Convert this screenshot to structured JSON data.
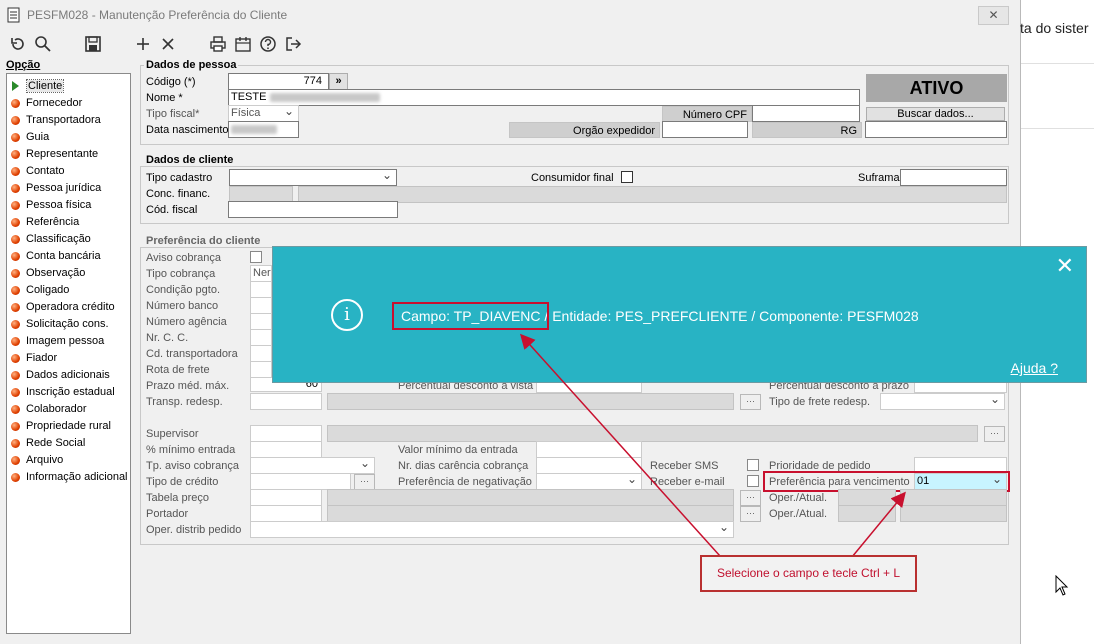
{
  "window": {
    "title": "PESFM028 - Manutenção Preferência do Cliente",
    "close": "✕"
  },
  "toolbar": {
    "icons": [
      "undo-icon",
      "search-icon",
      "save-icon",
      "add-icon",
      "delete-icon",
      "print-icon",
      "calendar-icon",
      "help-icon",
      "exit-icon"
    ]
  },
  "sidebar": {
    "heading": "Opção",
    "items": [
      "Cliente",
      "Fornecedor",
      "Transportadora",
      "Guia",
      "Representante",
      "Contato",
      "Pessoa jurídica",
      "Pessoa física",
      "Referência",
      "Classificação",
      "Conta bancária",
      "Observação",
      "Coligado",
      "Operadora crédito",
      "Solicitação cons.",
      "Imagem pessoa",
      "Fiador",
      "Dados adicionais",
      "Inscrição estadual",
      "Colaborador",
      "Propriedade rural",
      "Rede Social",
      "Arquivo",
      "Informação adicional"
    ],
    "selected": "Cliente"
  },
  "pessoa": {
    "group_title": "Dados de pessoa",
    "codigo_label": "Código (*)",
    "codigo_value": "774",
    "codigo_btn": "»",
    "nome_label": "Nome *",
    "nome_value": "TESTE",
    "tipo_fiscal_label": "Tipo fiscal*",
    "tipo_fiscal_value": "Física",
    "data_nasc_label": "Data nascimento",
    "numero_cpf_label": "Número CPF",
    "orgao_label": "Orgão expedidor",
    "rg_label": "RG",
    "status": "ATIVO",
    "buscar_btn": "Buscar dados..."
  },
  "cliente": {
    "group_title": "Dados de cliente",
    "tipo_cadastro_label": "Tipo cadastro",
    "consumidor_final_label": "Consumidor final",
    "suframa_label": "Suframa",
    "conc_financ_label": "Conc. financ.",
    "cod_fiscal_label": "Cód. fiscal"
  },
  "preferencia": {
    "group_title": "Preferência do cliente",
    "aviso_cobranca": "Aviso cobrança",
    "tipo_cobranca": "Tipo cobrança",
    "tipo_cobranca_value": "Ner",
    "condicao_pgto": "Condição pgto.",
    "numero_banco": "Número banco",
    "numero_agencia": "Número agência",
    "nr_cc": "Nr. C. C.",
    "cd_transportadora": "Cd. transportadora",
    "rota_frete": "Rota de frete",
    "prazo_med_max": "Prazo méd. máx.",
    "prazo_value": "60",
    "percentual_vista": "Percentual desconto à vista",
    "percentual_prazo": "Percentual desconto à prazo",
    "transp_redesp": "Transp. redesp.",
    "tipo_frete_redesp": "Tipo de frete redesp.",
    "supervisor": "Supervisor",
    "pct_minimo_entrada": "% mínimo entrada",
    "valor_minimo_entrada": "Valor mínimo da entrada",
    "tp_aviso_cobranca": "Tp. aviso cobrança",
    "nr_dias_carencia": "Nr. dias carência cobrança",
    "receber_sms": "Receber SMS",
    "prioridade_pedido": "Prioridade de pedido",
    "tipo_credito": "Tipo de crédito",
    "pref_negativacao": "Preferência de negativação",
    "receber_email": "Receber e-mail",
    "pref_vencimento": "Preferência para vencimento",
    "pref_vencimento_value": "01",
    "tabela_preco": "Tabela preço",
    "oper_atual_1": "Oper./Atual.",
    "portador": "Portador",
    "oper_atual_2": "Oper./Atual.",
    "oper_distrib": "Oper. distrib pedido"
  },
  "popup": {
    "message": "Campo: TP_DIAVENC / Entidade: PES_PREFCLIENTE / Componente: PESFM028",
    "help": "Ajuda ?",
    "close": "✕",
    "info": "i"
  },
  "callout": {
    "text": "Selecione o campo e tecle Ctrl + L"
  },
  "background_app": {
    "partial_text": "ta do sister"
  },
  "colors": {
    "popup_bg": "#28b3c4",
    "highlight_red": "#c8102e",
    "selected_field": "#c8f4ff"
  }
}
